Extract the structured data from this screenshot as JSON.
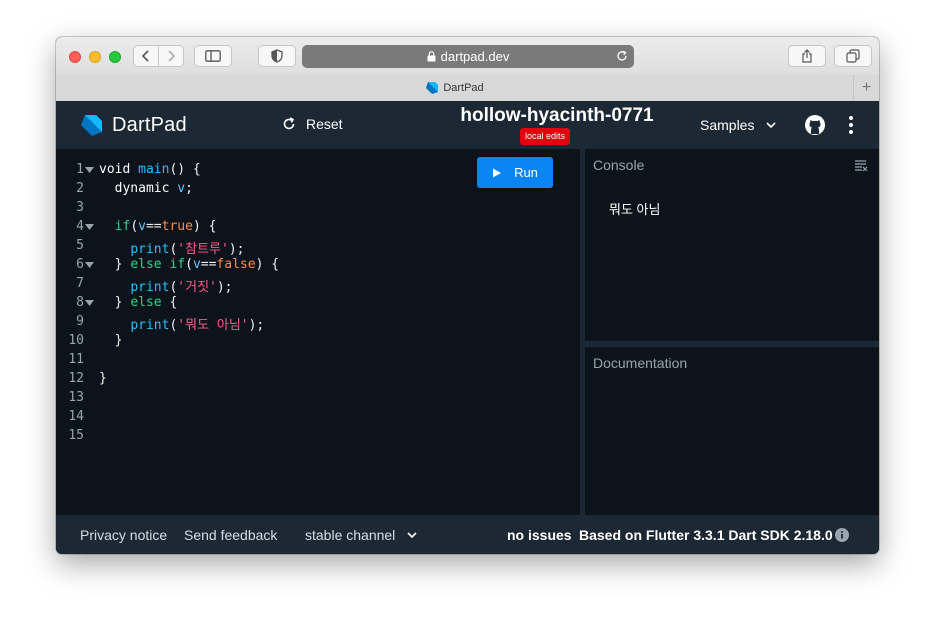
{
  "browser": {
    "url": "dartpad.dev",
    "tab_title": "DartPad",
    "new_tab_symbol": "+"
  },
  "app": {
    "name": "DartPad",
    "reset_label": "Reset",
    "pad_title": "hollow-hyacinth-0771",
    "edit_badge": "local edits",
    "samples_label": "Samples",
    "run_label": "Run"
  },
  "editor": {
    "line_numbers": [
      "1",
      "2",
      "3",
      "4",
      "5",
      "6",
      "7",
      "8",
      "9",
      "10",
      "11",
      "12",
      "13",
      "14",
      "15"
    ],
    "folded_lines": [
      1,
      4,
      6,
      8
    ],
    "lines": [
      [
        {
          "t": "void ",
          "c": "kw"
        },
        {
          "t": "main",
          "c": "fn"
        },
        {
          "t": "() {",
          "c": ""
        }
      ],
      [
        {
          "t": "  dynamic ",
          "c": "kw"
        },
        {
          "t": "v",
          "c": "var"
        },
        {
          "t": ";",
          "c": ""
        }
      ],
      [],
      [
        {
          "t": "  ",
          "c": ""
        },
        {
          "t": "if",
          "c": "kw2"
        },
        {
          "t": "(",
          "c": ""
        },
        {
          "t": "v",
          "c": "var"
        },
        {
          "t": "==",
          "c": ""
        },
        {
          "t": "true",
          "c": "bool"
        },
        {
          "t": ") {",
          "c": ""
        }
      ],
      [
        {
          "t": "    ",
          "c": ""
        },
        {
          "t": "print",
          "c": "fn"
        },
        {
          "t": "(",
          "c": ""
        },
        {
          "t": "'참트루'",
          "c": "str"
        },
        {
          "t": ");",
          "c": ""
        }
      ],
      [
        {
          "t": "  } ",
          "c": ""
        },
        {
          "t": "else if",
          "c": "kw2"
        },
        {
          "t": "(",
          "c": ""
        },
        {
          "t": "v",
          "c": "var"
        },
        {
          "t": "==",
          "c": ""
        },
        {
          "t": "false",
          "c": "bool"
        },
        {
          "t": ") {",
          "c": ""
        }
      ],
      [
        {
          "t": "    ",
          "c": ""
        },
        {
          "t": "print",
          "c": "fn"
        },
        {
          "t": "(",
          "c": ""
        },
        {
          "t": "'거짓'",
          "c": "str"
        },
        {
          "t": ");",
          "c": ""
        }
      ],
      [
        {
          "t": "  } ",
          "c": ""
        },
        {
          "t": "else",
          "c": "kw2"
        },
        {
          "t": " {",
          "c": ""
        }
      ],
      [
        {
          "t": "    ",
          "c": ""
        },
        {
          "t": "print",
          "c": "fn"
        },
        {
          "t": "(",
          "c": ""
        },
        {
          "t": "'뭐도 아님'",
          "c": "str"
        },
        {
          "t": ");",
          "c": ""
        }
      ],
      [
        {
          "t": "  }",
          "c": ""
        }
      ],
      [],
      [
        {
          "t": "}",
          "c": ""
        }
      ],
      [],
      [],
      []
    ]
  },
  "console": {
    "title": "Console",
    "output": "뭐도 아님"
  },
  "documentation": {
    "title": "Documentation"
  },
  "footer": {
    "privacy": "Privacy notice",
    "feedback": "Send feedback",
    "channel": "stable channel",
    "issues": "no issues",
    "version": "Based on Flutter 3.3.1 Dart SDK 2.18.0"
  },
  "colors": {
    "accent": "#0b84f5",
    "badge": "#e3000f",
    "appbar": "#1c2834",
    "editor_bg": "#0d131b"
  }
}
